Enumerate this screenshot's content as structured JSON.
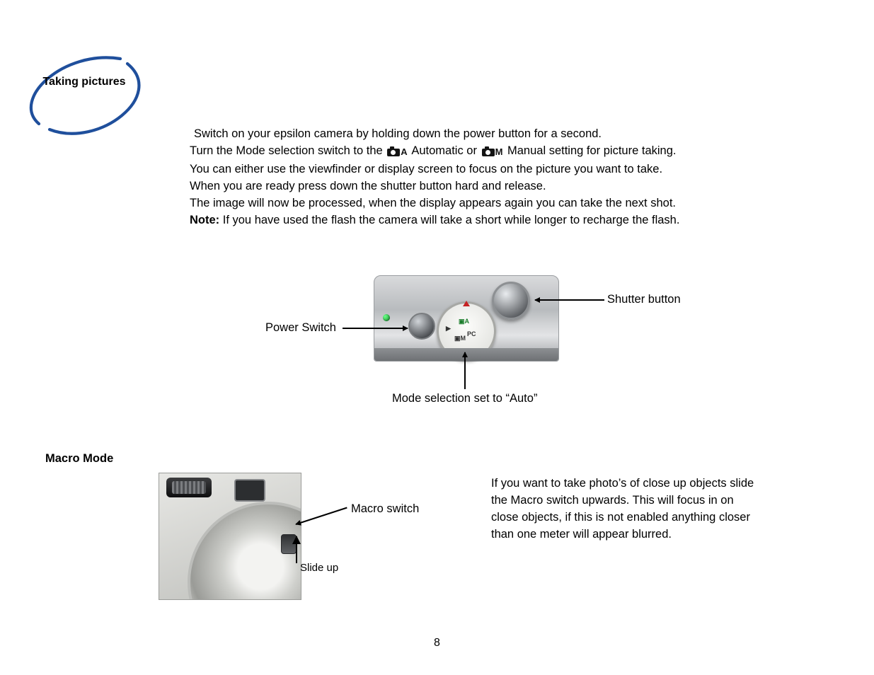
{
  "header": {
    "title": "Taking pictures"
  },
  "body": {
    "line1": "Switch on your epsilon camera by holding down the power button for a second.",
    "line2a": "Turn the Mode selection switch to the ",
    "line2b": " Automatic or ",
    "line2c": " Manual setting for picture taking.",
    "line3": "You can either use the viewfinder or display screen to focus on the picture you want to take.",
    "line4": "When you are ready press down the shutter button hard and release.",
    "line5": "The image will now be processed, when the display appears again you can take the next shot.",
    "note_label": "Note:",
    "note_text": " If you have used the flash the camera will take a short while longer to recharge the flash."
  },
  "fig1": {
    "power": "Power Switch",
    "shutter": "Shutter button",
    "mode": "Mode selection set to “Auto”"
  },
  "macro": {
    "title": "Macro Mode",
    "switch_label": "Macro switch",
    "slide": "Slide up",
    "para": "If you want to take photo’s of close up objects slide the Macro switch upwards. This will focus in on close objects, if this is not enabled anything closer than one meter will appear blurred."
  },
  "page_number": "8"
}
